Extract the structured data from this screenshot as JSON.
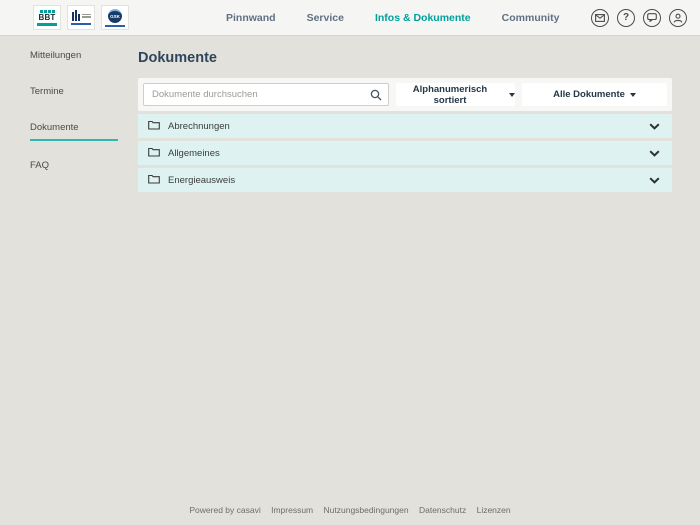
{
  "header": {
    "logos": [
      {
        "text": "BBT"
      },
      {
        "text": ""
      },
      {
        "text": "GSK"
      }
    ],
    "nav": [
      {
        "label": "Pinnwand"
      },
      {
        "label": "Service"
      },
      {
        "label": "Infos & Dokumente",
        "active": true
      },
      {
        "label": "Community"
      }
    ],
    "icons": [
      {
        "name": "mail-icon"
      },
      {
        "name": "help-icon"
      },
      {
        "name": "feedback-icon"
      },
      {
        "name": "account-icon"
      }
    ]
  },
  "sidebar": {
    "items": [
      {
        "label": "Mitteilungen"
      },
      {
        "label": "Termine"
      },
      {
        "label": "Dokumente",
        "active": true
      },
      {
        "label": "FAQ"
      }
    ]
  },
  "main": {
    "title": "Dokumente",
    "search": {
      "placeholder": "Dokumente durchsuchen"
    },
    "sort_button": {
      "label": "Alphanumerisch sortiert"
    },
    "filter_button": {
      "label": "Alle Dokumente"
    },
    "folders": [
      {
        "label": "Abrechnungen"
      },
      {
        "label": "Allgemeines"
      },
      {
        "label": "Energieausweis"
      }
    ]
  },
  "footer": {
    "powered_by": "Powered by casavi",
    "links": [
      {
        "label": "Impressum"
      },
      {
        "label": "Nutzungsbedingungen"
      },
      {
        "label": "Datenschutz"
      },
      {
        "label": "Lizenzen"
      }
    ]
  },
  "colors": {
    "accent": "#00a19d",
    "accordion_bg": "#ddf2f1",
    "page_bg": "#e2e1dc",
    "header_bg": "#f5f5f3",
    "heading_text": "#30455a",
    "nav_text": "#607083"
  }
}
